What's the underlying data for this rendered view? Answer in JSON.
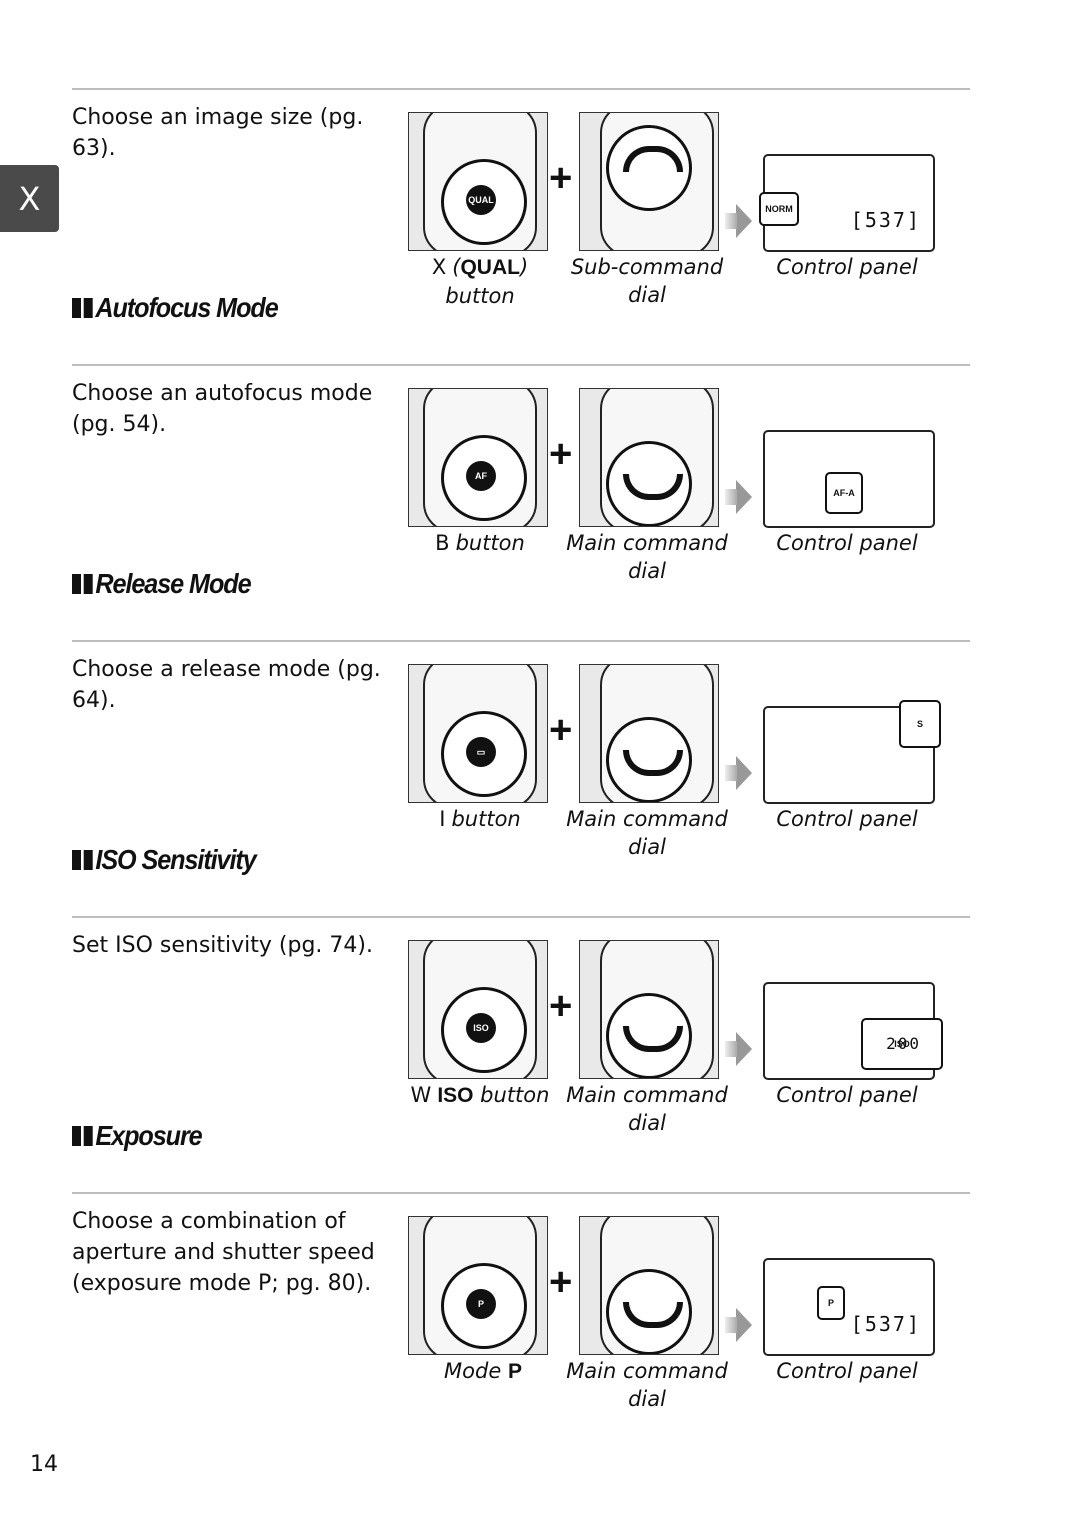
{
  "side_tab": "X",
  "page_number": "14",
  "sections": [
    {
      "heading": "",
      "description": "Choose an image size (pg. 63).",
      "button_caption": {
        "key": "X",
        "pre": "(",
        "bold": "QUAL",
        "post": ") button"
      },
      "dial_caption": [
        "Sub-command",
        "dial"
      ],
      "panel_caption": "Control panel",
      "button_label": "QUAL",
      "panel_text": "NORM",
      "panel_value": "[537]"
    },
    {
      "heading": "Autofocus Mode",
      "description": "Choose an autofocus mode (pg. 54).",
      "button_caption": {
        "key": "B",
        "pre": "",
        "bold": "",
        "post": "button"
      },
      "dial_caption": [
        "Main command",
        "dial"
      ],
      "panel_caption": "Control panel",
      "button_label": "AF",
      "panel_text": "AF-A",
      "panel_value": ""
    },
    {
      "heading": "Release Mode",
      "description": "Choose a release mode (pg. 64).",
      "button_caption": {
        "key": "I",
        "pre": "",
        "bold": "",
        "post": "button"
      },
      "dial_caption": [
        "Main command",
        "dial"
      ],
      "panel_caption": "Control panel",
      "button_label": "▭",
      "panel_text": "S",
      "panel_value": ""
    },
    {
      "heading": "ISO Sensitivity",
      "description": "Set ISO sensitivity (pg. 74).",
      "button_caption": {
        "key": "W",
        "pre": "",
        "bold": "ISO",
        "post": " button"
      },
      "dial_caption": [
        "Main command",
        "dial"
      ],
      "panel_caption": "Control panel",
      "button_label": "ISO",
      "panel_text": "ISO",
      "panel_value": "200"
    },
    {
      "heading": "Exposure",
      "description": "Choose a combination of aperture and shutter speed (exposure mode P; pg. 80).",
      "button_caption": {
        "key": "",
        "pre": "Mode ",
        "bold": "P",
        "post": ""
      },
      "dial_caption": [
        "Main command",
        "dial"
      ],
      "panel_caption": "Control panel",
      "button_label": "P",
      "panel_text": "P",
      "panel_value": "[537]"
    }
  ]
}
